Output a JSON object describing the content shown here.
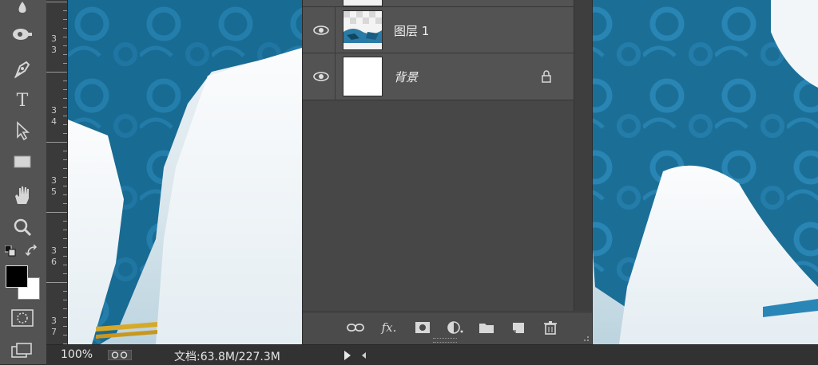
{
  "toolbar": {
    "tools": [
      {
        "name": "blur-tool-icon"
      },
      {
        "name": "dodge-tool-icon"
      },
      {
        "name": "pen-tool-icon"
      },
      {
        "name": "type-tool-icon",
        "glyph": "T"
      },
      {
        "name": "path-selection-tool-icon"
      },
      {
        "name": "rectangle-tool-icon"
      },
      {
        "name": "hand-tool-icon"
      },
      {
        "name": "zoom-tool-icon"
      }
    ],
    "foreground_color": "#000000",
    "background_color": "#ffffff"
  },
  "ruler": {
    "labels": [
      {
        "a": "3",
        "b": "3"
      },
      {
        "a": "3",
        "b": "4"
      },
      {
        "a": "3",
        "b": "5"
      },
      {
        "a": "3",
        "b": "6"
      },
      {
        "a": "3",
        "b": "7"
      }
    ]
  },
  "layers": {
    "items": [
      {
        "name": "图层 1",
        "visible": true,
        "locked": false
      },
      {
        "name": "背景",
        "visible": true,
        "locked": true
      }
    ]
  },
  "status": {
    "zoom": "100%",
    "doc_info": "文档:63.8M/227.3M"
  },
  "colors": {
    "accent_blue": "#1b6f97",
    "panel": "#474747"
  }
}
